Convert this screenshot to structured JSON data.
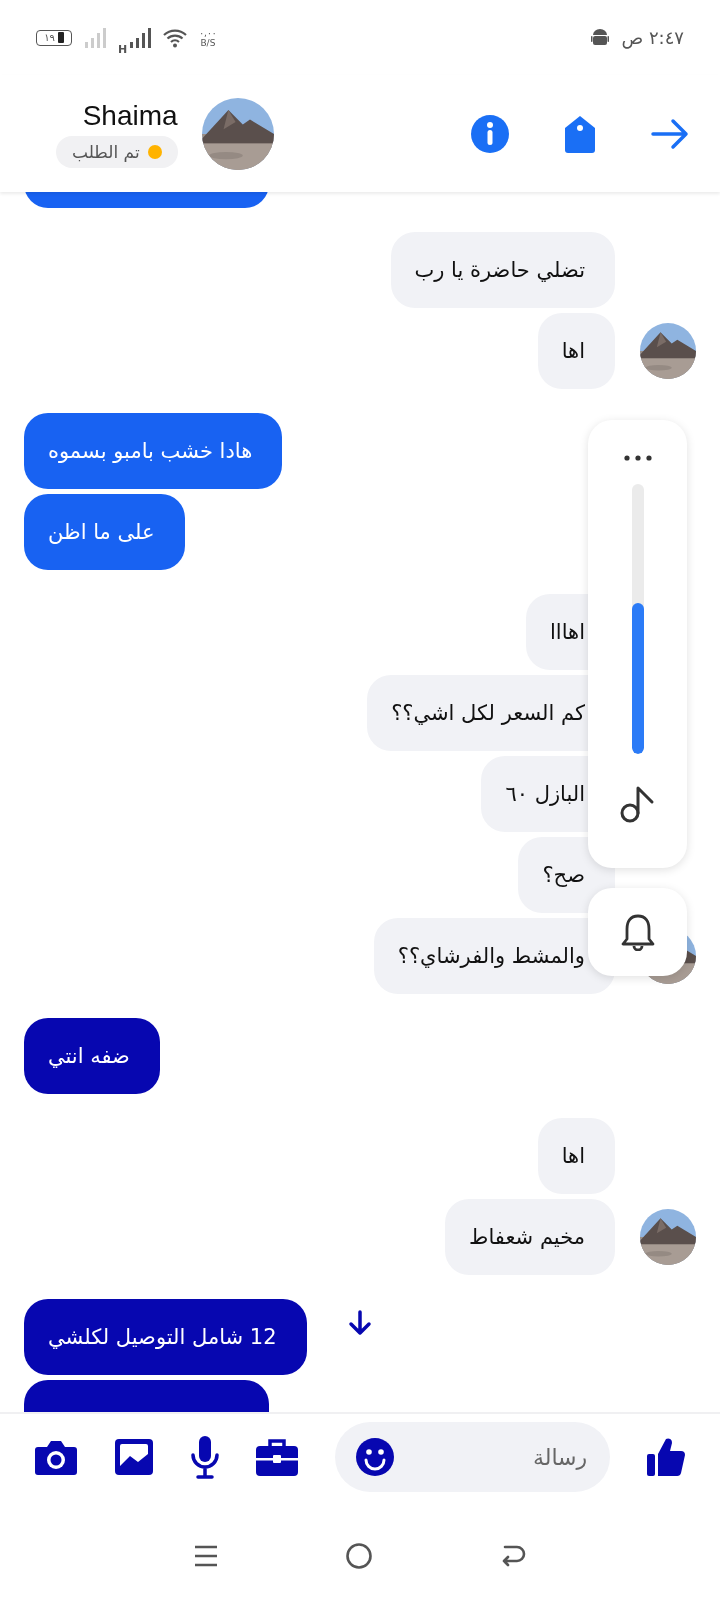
{
  "status_bar": {
    "time": "٢:٤٧ ص",
    "battery": "١٩",
    "network": "H",
    "speed": "٠,٠٠",
    "speed_unit": "B/S"
  },
  "header": {
    "name": "Shaima",
    "status": "تم الطلب",
    "color": "#ffb300"
  },
  "messages": [
    {
      "kind": "sent",
      "color": "#1862f2"
    },
    {
      "kind": "received",
      "text": "تضلي حاضرة يا رب",
      "avatar": false
    },
    {
      "kind": "received",
      "text": "اها",
      "avatar": true
    },
    {
      "kind": "sent",
      "text": "هادا خشب بامبو بسموه",
      "color": "#1862f2"
    },
    {
      "kind": "sent",
      "text": "على ما اظن",
      "color": "#1862f2"
    },
    {
      "kind": "received",
      "text": "اهااا",
      "avatar": false
    },
    {
      "kind": "received",
      "text": "كم السعر لكل اشي؟؟",
      "avatar": false
    },
    {
      "kind": "received",
      "text": "البازل ٦٠",
      "avatar": false
    },
    {
      "kind": "received",
      "text": "صح؟",
      "avatar": false
    },
    {
      "kind": "received",
      "text": "والمشط والفرشاي؟؟",
      "avatar": true
    },
    {
      "kind": "sent",
      "text": "ضفه انتي",
      "color": "#0707b0"
    },
    {
      "kind": "received",
      "text": "اها",
      "avatar": false
    },
    {
      "kind": "received",
      "text": "مخيم شعفاط",
      "avatar": true
    },
    {
      "kind": "sent",
      "text": "12 شامل التوصيل لكلشي",
      "color": "#0707b0"
    },
    {
      "kind": "sent",
      "color": "#0707b0"
    }
  ],
  "volume_panel": {
    "level": 0.56
  },
  "composer": {
    "placeholder": "رسالة"
  }
}
